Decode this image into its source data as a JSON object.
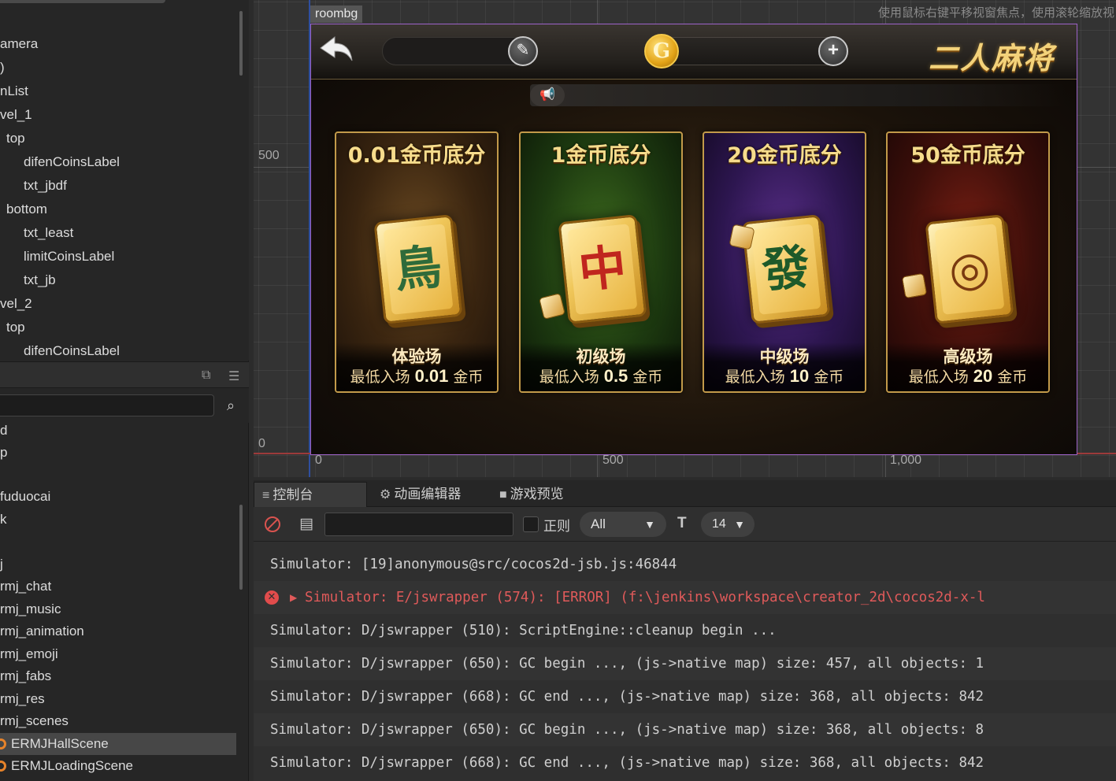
{
  "hierarchy": {
    "items": [
      {
        "label": "amera"
      },
      {
        "label": ")"
      },
      {
        "label": "nList"
      },
      {
        "label": "vel_1"
      },
      {
        "label": "top"
      },
      {
        "label": "difenCoinsLabel"
      },
      {
        "label": "txt_jbdf"
      },
      {
        "label": "bottom"
      },
      {
        "label": "txt_least"
      },
      {
        "label": "limitCoinsLabel"
      },
      {
        "label": "txt_jb"
      },
      {
        "label": "vel_2"
      },
      {
        "label": "top"
      },
      {
        "label": "difenCoinsLabel"
      }
    ]
  },
  "assets": {
    "search_value": "",
    "items": [
      {
        "label": "d"
      },
      {
        "label": "p"
      },
      {
        "label": ""
      },
      {
        "label": "fuduocai"
      },
      {
        "label": "k"
      },
      {
        "label": ""
      },
      {
        "label": "j"
      },
      {
        "label": "rmj_chat"
      },
      {
        "label": "rmj_music"
      },
      {
        "label": "rmj_animation"
      },
      {
        "label": "rmj_emoji"
      },
      {
        "label": "rmj_fabs"
      },
      {
        "label": "rmj_res"
      },
      {
        "label": "rmj_scenes"
      },
      {
        "label": "ERMJHallScene",
        "selected": true
      },
      {
        "label": "ERMJLoadingScene"
      }
    ]
  },
  "scene": {
    "hint": "使用鼠标右键平移视窗焦点，使用滚轮缩放视",
    "node_label": "roombg",
    "ruler": {
      "y500": "500",
      "y0": "0",
      "x0": "0",
      "x500": "500",
      "x1000": "1,000"
    }
  },
  "game": {
    "title": "二人麻将",
    "edit_icon": "✎",
    "coin_symbol": "G",
    "add_label": "+",
    "rooms": [
      {
        "title": "0.01金币底分",
        "tile": "鳥",
        "level": "体验场",
        "min_prefix": "最低入场",
        "min_value": "0.01",
        "min_suffix": "金币",
        "theme": "brown"
      },
      {
        "title": "1金币底分",
        "tile": "中",
        "level": "初级场",
        "min_prefix": "最低入场",
        "min_value": "0.5",
        "min_suffix": "金币",
        "theme": "green"
      },
      {
        "title": "20金币底分",
        "tile": "發",
        "level": "中级场",
        "min_prefix": "最低入场",
        "min_value": "10",
        "min_suffix": "金币",
        "theme": "purple"
      },
      {
        "title": "50金币底分",
        "tile": "◎",
        "level": "高级场",
        "min_prefix": "最低入场",
        "min_value": "20",
        "min_suffix": "金币",
        "theme": "red"
      }
    ]
  },
  "console": {
    "tabs": [
      {
        "icon": "≡",
        "label": "控制台"
      },
      {
        "icon": "⚙",
        "label": "动画编辑器"
      },
      {
        "icon": "■",
        "label": "游戏预览"
      }
    ],
    "filter_value": "",
    "regex_label": "正则",
    "level_value": "All",
    "font_icon": "T",
    "size_value": "14",
    "logs": [
      {
        "type": "info",
        "text": "Simulator: [19]anonymous@src/cocos2d-jsb.js:46844"
      },
      {
        "type": "error",
        "text": "Simulator: E/jswrapper (574): [ERROR] (f:\\jenkins\\workspace\\creator_2d\\cocos2d-x-l"
      },
      {
        "type": "info",
        "text": "Simulator: D/jswrapper (510): ScriptEngine::cleanup begin ..."
      },
      {
        "type": "info",
        "text": "Simulator: D/jswrapper (650): GC begin ..., (js->native map) size: 457, all objects: 1"
      },
      {
        "type": "info",
        "text": "Simulator: D/jswrapper (668): GC end ..., (js->native map) size: 368, all objects: 842"
      },
      {
        "type": "info",
        "text": "Simulator: D/jswrapper (650): GC begin ..., (js->native map) size: 368, all objects: 8"
      },
      {
        "type": "info",
        "text": "Simulator: D/jswrapper (668): GC end ..., (js->native map) size: 368, all objects: 842"
      }
    ]
  },
  "colors": {
    "accent_error": "#e05a5a",
    "canvas_border": "#9d62c8",
    "title_gold": "#f3d27a"
  }
}
